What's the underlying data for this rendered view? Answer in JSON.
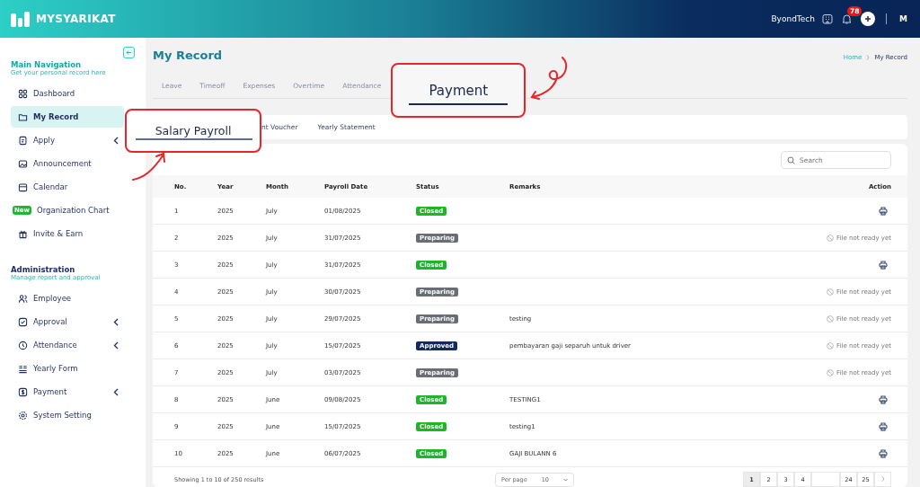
{
  "topbar": {
    "brand": "MYSYARIKAT",
    "company": "ByondTech",
    "notification_count": "78",
    "user_initial": "M"
  },
  "sidebar": {
    "sections": [
      {
        "title": "Main Navigation",
        "subtitle": "Get your personal record here",
        "items": [
          {
            "label": "Dashboard",
            "selected": false,
            "submenu": false
          },
          {
            "label": "My Record",
            "selected": true,
            "submenu": false
          },
          {
            "label": "Apply",
            "selected": false,
            "submenu": true
          },
          {
            "label": "Announcement",
            "selected": false,
            "submenu": false
          },
          {
            "label": "Calendar",
            "selected": false,
            "submenu": false
          },
          {
            "label": "Organization Chart",
            "selected": false,
            "submenu": false,
            "badge": "New"
          },
          {
            "label": "Invite & Earn",
            "selected": false,
            "submenu": false
          }
        ]
      },
      {
        "title": "Administration",
        "subtitle": "Manage report and approval",
        "items": [
          {
            "label": "Employee",
            "selected": false,
            "submenu": false
          },
          {
            "label": "Approval",
            "selected": false,
            "submenu": true
          },
          {
            "label": "Attendance",
            "selected": false,
            "submenu": true
          },
          {
            "label": "Yearly Form",
            "selected": false,
            "submenu": false
          },
          {
            "label": "Payment",
            "selected": false,
            "submenu": true
          },
          {
            "label": "System Setting",
            "selected": false,
            "submenu": false
          }
        ]
      }
    ]
  },
  "page": {
    "title": "My Record",
    "breadcrumb": [
      "Home",
      "My Record"
    ]
  },
  "tabs": [
    {
      "label": "Leave",
      "selected": false
    },
    {
      "label": "Timeoff",
      "selected": false
    },
    {
      "label": "Expenses",
      "selected": false
    },
    {
      "label": "Overtime",
      "selected": false
    },
    {
      "label": "Attendance",
      "selected": false
    },
    {
      "label": "Payment",
      "selected": true
    }
  ],
  "subtabs": [
    {
      "label": "Salary Payroll",
      "selected": true
    },
    {
      "label": "nt Voucher",
      "selected": false
    },
    {
      "label": "Yearly Statement",
      "selected": false
    }
  ],
  "search": {
    "placeholder": "Search"
  },
  "table": {
    "columns": [
      "No.",
      "Year",
      "Month",
      "Payroll Date",
      "Status",
      "Remarks",
      "Action"
    ],
    "rows": [
      {
        "no": "1",
        "year": "2025",
        "month": "July",
        "date": "01/08/2025",
        "status": {
          "label": "Closed",
          "color": "#1fb52a"
        },
        "remarks": "",
        "action": {
          "kind": "print"
        }
      },
      {
        "no": "2",
        "year": "2025",
        "month": "July",
        "date": "31/07/2025",
        "status": {
          "label": "Preparing",
          "color": "#6b6d76"
        },
        "remarks": "",
        "action": {
          "kind": "not_ready",
          "text": "File not ready yet"
        }
      },
      {
        "no": "3",
        "year": "2025",
        "month": "July",
        "date": "31/07/2025",
        "status": {
          "label": "Closed",
          "color": "#1fb52a"
        },
        "remarks": "",
        "action": {
          "kind": "print"
        }
      },
      {
        "no": "4",
        "year": "2025",
        "month": "July",
        "date": "30/07/2025",
        "status": {
          "label": "Preparing",
          "color": "#6b6d76"
        },
        "remarks": "",
        "action": {
          "kind": "not_ready",
          "text": "File not ready yet"
        }
      },
      {
        "no": "5",
        "year": "2025",
        "month": "July",
        "date": "29/07/2025",
        "status": {
          "label": "Preparing",
          "color": "#6b6d76"
        },
        "remarks": "testing",
        "action": {
          "kind": "not_ready",
          "text": "File not ready yet"
        }
      },
      {
        "no": "6",
        "year": "2025",
        "month": "July",
        "date": "15/07/2025",
        "status": {
          "label": "Approved",
          "color": "#15295e"
        },
        "remarks": "pembayaran gaji separuh untuk driver",
        "action": {
          "kind": "not_ready",
          "text": "File not ready yet"
        }
      },
      {
        "no": "7",
        "year": "2025",
        "month": "July",
        "date": "03/07/2025",
        "status": {
          "label": "Preparing",
          "color": "#6b6d76"
        },
        "remarks": "",
        "action": {
          "kind": "not_ready",
          "text": "File not ready yet"
        }
      },
      {
        "no": "8",
        "year": "2025",
        "month": "June",
        "date": "09/08/2025",
        "status": {
          "label": "Closed",
          "color": "#1fb52a"
        },
        "remarks": "TESTING1",
        "action": {
          "kind": "print"
        }
      },
      {
        "no": "9",
        "year": "2025",
        "month": "June",
        "date": "15/07/2025",
        "status": {
          "label": "Closed",
          "color": "#1fb52a"
        },
        "remarks": "testing1",
        "action": {
          "kind": "print"
        }
      },
      {
        "no": "10",
        "year": "2025",
        "month": "June",
        "date": "06/07/2025",
        "status": {
          "label": "Closed",
          "color": "#1fb52a"
        },
        "remarks": "GAJI BULANN 6",
        "action": {
          "kind": "print"
        }
      }
    ]
  },
  "footer": {
    "summary": "Showing 1 to 10 of 250 results",
    "per_page": {
      "label": "Per page",
      "value": "10"
    },
    "pages": [
      {
        "kind": "page",
        "label": "1",
        "selected": true
      },
      {
        "kind": "page",
        "label": "2",
        "selected": false
      },
      {
        "kind": "page",
        "label": "3",
        "selected": false
      },
      {
        "kind": "page",
        "label": "4",
        "selected": false
      },
      {
        "kind": "gap"
      },
      {
        "kind": "page",
        "label": "24",
        "selected": false
      },
      {
        "kind": "page",
        "label": "25",
        "selected": false
      },
      {
        "kind": "next"
      }
    ]
  }
}
